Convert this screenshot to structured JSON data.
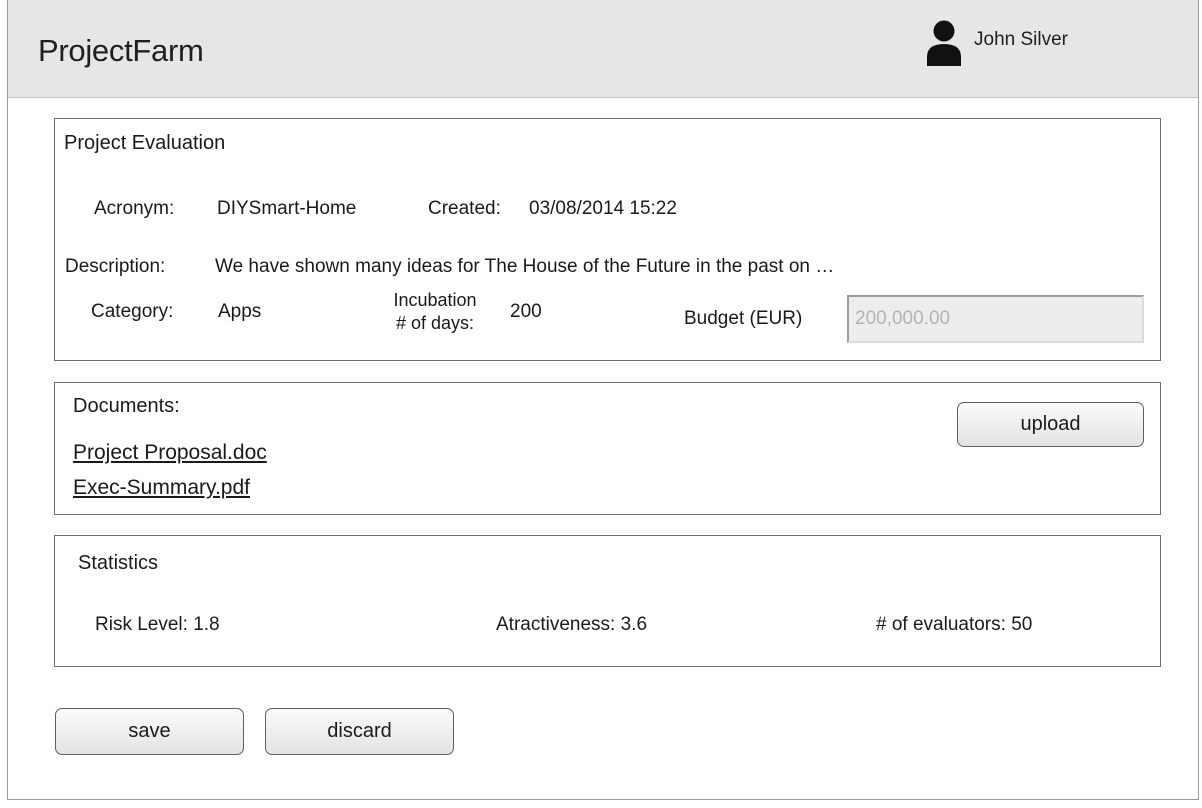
{
  "app": {
    "title": "ProjectFarm",
    "user_name": "John Silver"
  },
  "evaluation": {
    "section_title": "Project Evaluation",
    "acronym_label": "Acronym:",
    "acronym_value": "DIYSmart-Home",
    "created_label": "Created:",
    "created_value": "03/08/2014 15:22",
    "description_label": "Description:",
    "description_value": "We have shown many ideas for The House of the Future in the past on …",
    "category_label": "Category:",
    "category_value": "Apps",
    "incubation_label_line1": "Incubation",
    "incubation_label_line2": "# of days:",
    "incubation_value": "200",
    "budget_label": "Budget (EUR)",
    "budget_placeholder": "200,000.00"
  },
  "documents": {
    "section_title": "Documents:",
    "files": [
      "Project Proposal.doc",
      "Exec-Summary.pdf"
    ],
    "upload_label": "upload"
  },
  "statistics": {
    "section_title": "Statistics",
    "risk_level": "Risk Level: 1.8",
    "attractiveness": "Atractiveness: 3.6",
    "evaluators": "# of evaluators: 50"
  },
  "actions": {
    "save_label": "save",
    "discard_label": "discard"
  },
  "icons": {
    "user": "user-icon"
  },
  "colors": {
    "header_background": "#e6e6e6",
    "panel_border": "#6f6f6f",
    "input_background": "#ededed",
    "placeholder_text": "#b3b3b3"
  }
}
